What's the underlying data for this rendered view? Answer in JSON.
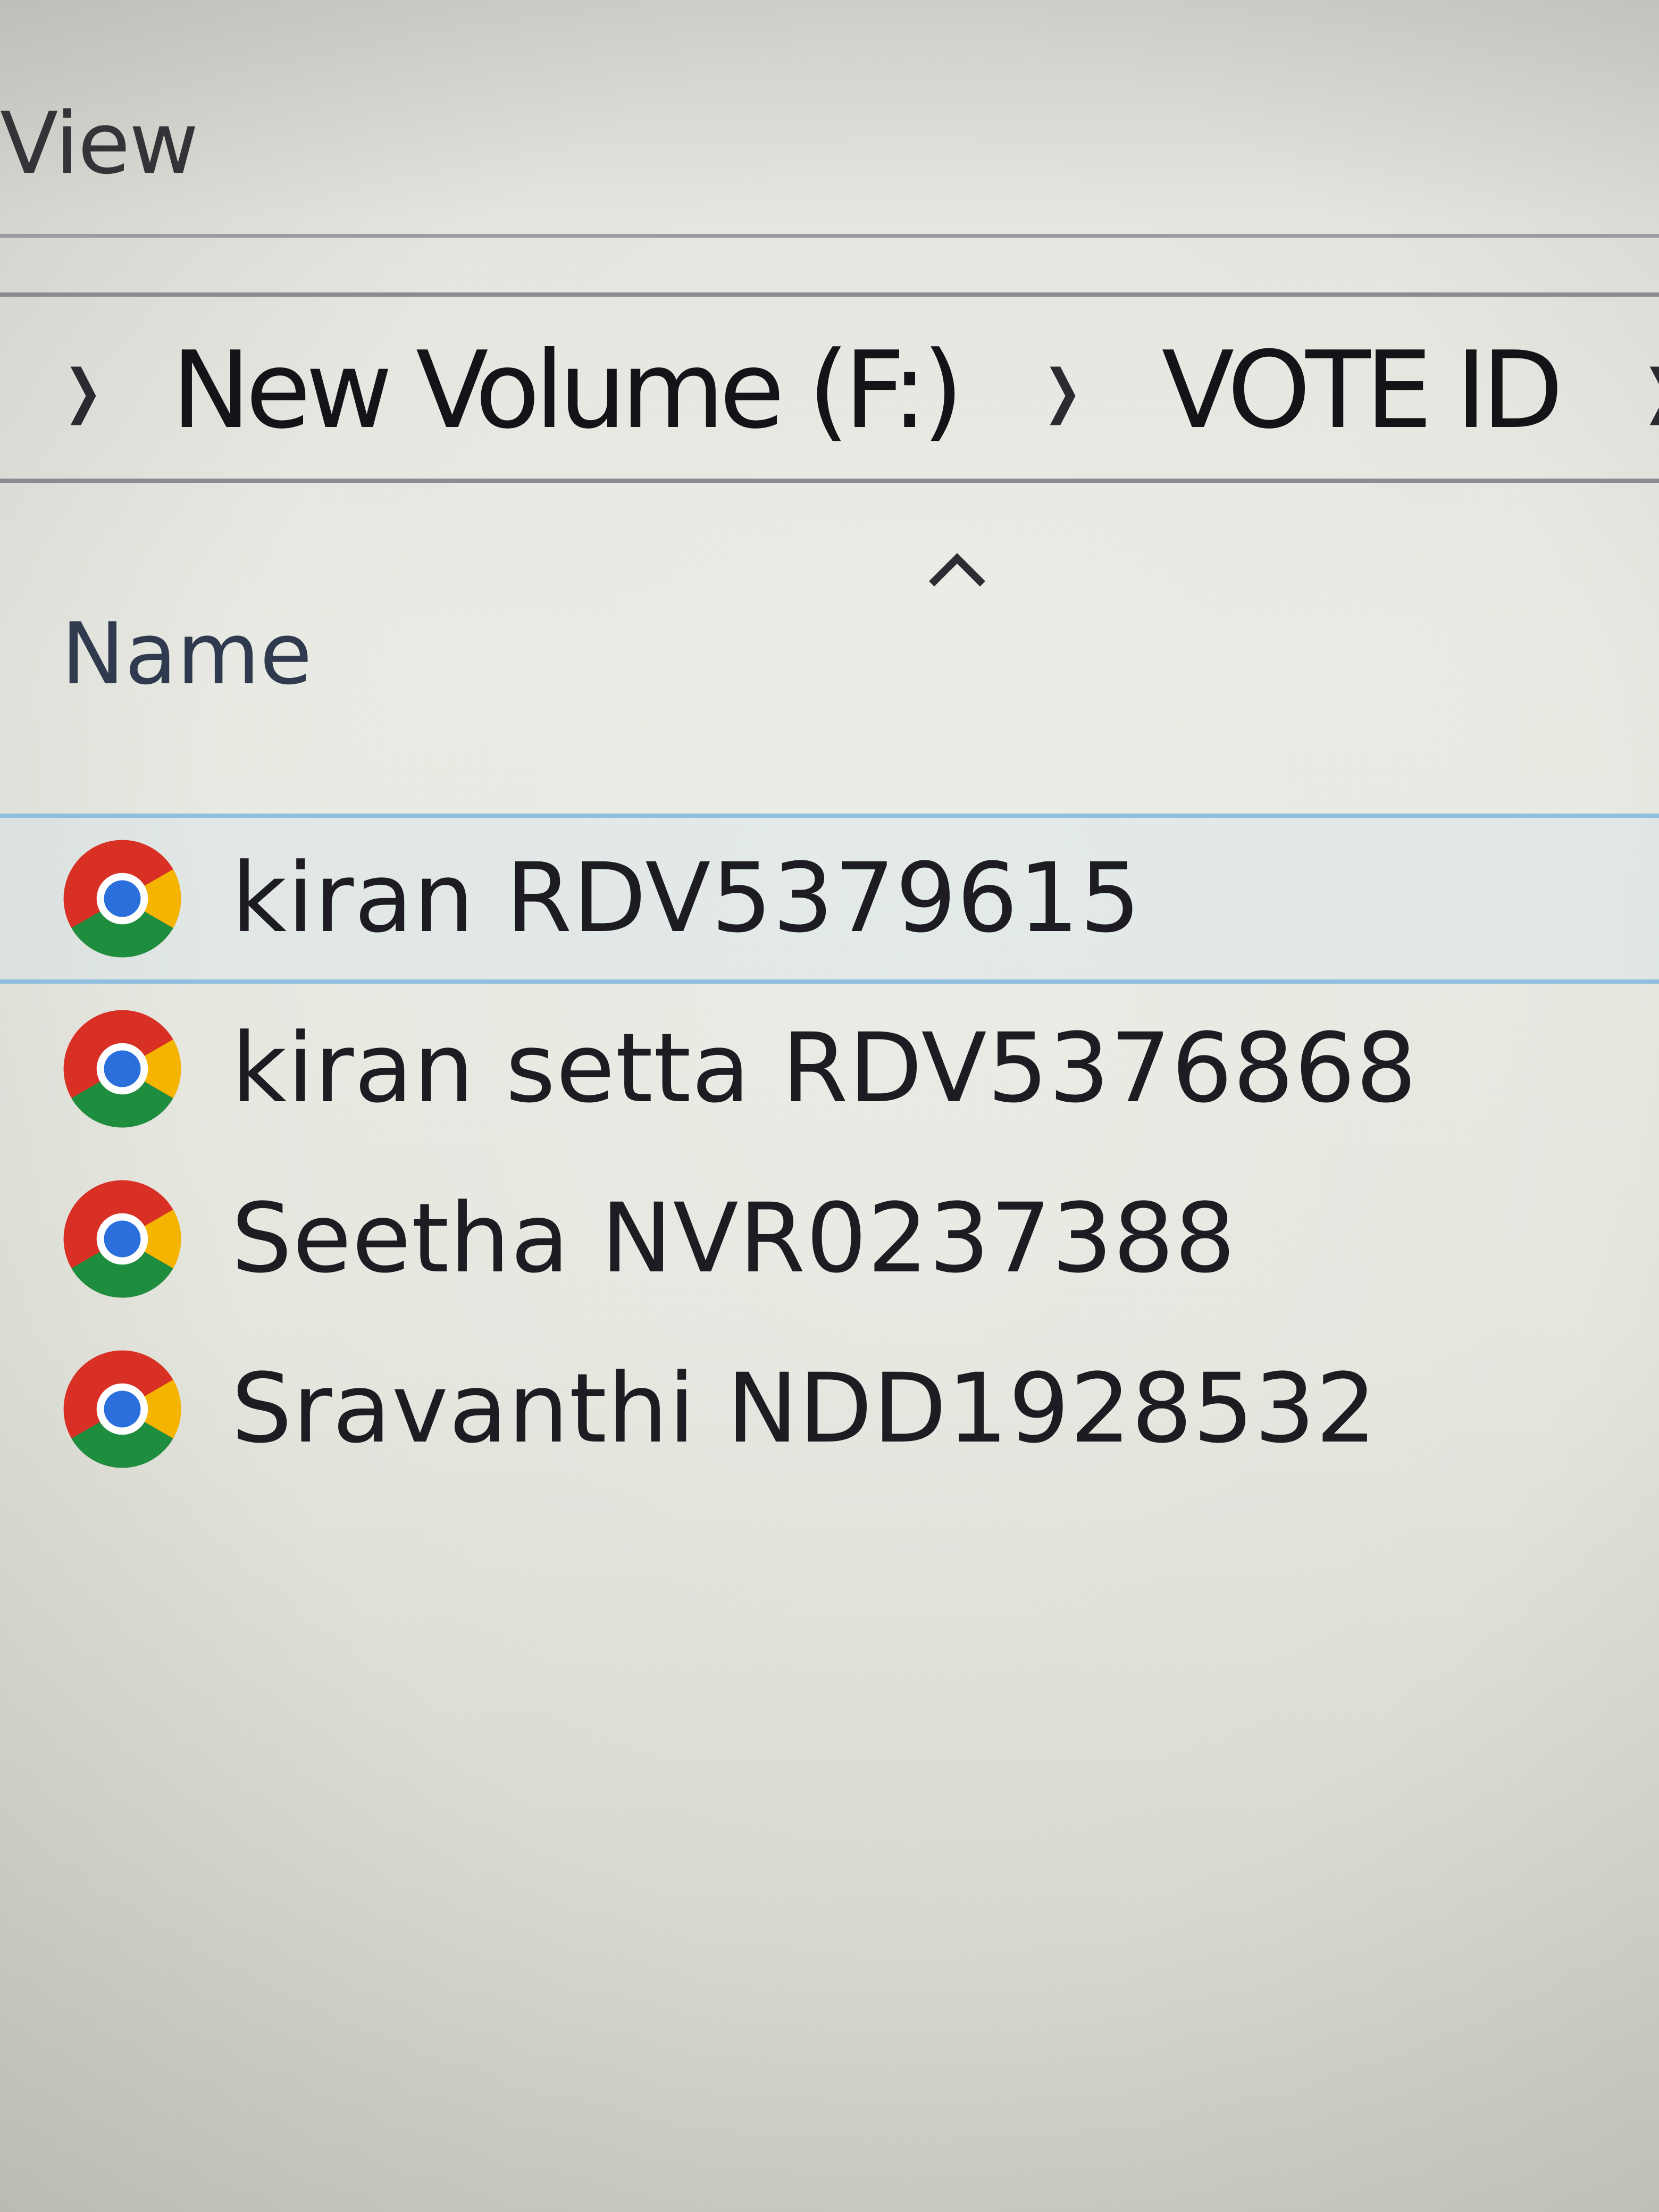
{
  "ribbon": {
    "view_tab": "View"
  },
  "address_bar": {
    "crumbs": [
      "New Volume (F:)",
      "VOTE ID"
    ]
  },
  "column_header": {
    "name_label": "Name",
    "sort": "ascending"
  },
  "files": [
    {
      "name": "kiran RDV5379615",
      "icon": "chrome-icon",
      "selected": true
    },
    {
      "name": "kiran setta RDV5376868",
      "icon": "chrome-icon",
      "selected": false
    },
    {
      "name": "Seetha NVR0237388",
      "icon": "chrome-icon",
      "selected": false
    },
    {
      "name": "Sravanthi NDD1928532",
      "icon": "chrome-icon",
      "selected": false
    }
  ],
  "colors": {
    "selection_border": "#8fbfe0",
    "chrome_red": "#d93025",
    "chrome_green": "#1e8e3e",
    "chrome_yellow": "#f4b400",
    "chrome_blue": "#2a6fdc"
  }
}
